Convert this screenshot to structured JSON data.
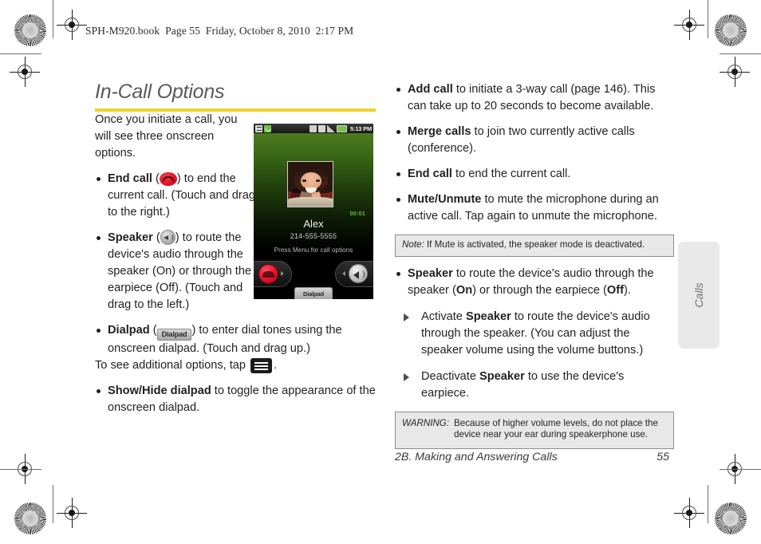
{
  "running_head": "SPH-M920.book  Page 55  Friday, October 8, 2010  2:17 PM",
  "section": {
    "title": "In-Call Options",
    "rule_color": "#edd42b"
  },
  "left_column": {
    "intro": "Once you initiate a call, you will see three onscreen options.",
    "bullets": [
      {
        "label": "End call",
        "icon": "end-call-icon",
        "text_before": " (",
        "text_after": ") to end the current call. (Touch and drag to the right.)"
      },
      {
        "label": "Speaker",
        "icon": "speaker-icon",
        "text_before": " (",
        "text_after": ") to route the device's audio through the speaker (On) or through the earpiece (Off). (Touch and drag to the left.)"
      },
      {
        "label": "Dialpad",
        "icon": "dialpad-icon",
        "icon_label": "Dialpad",
        "text_before": " (",
        "text_after": ") to enter dial tones using the onscreen dialpad. (Touch and drag up.)"
      }
    ],
    "additional_options_lead": "To see additional options, tap",
    "additional_options_icon": "menu-icon",
    "additional_options_end": ".",
    "show_hide_bullet": {
      "label": "Show/Hide dialpad",
      "text": " to toggle the appearance of the onscreen dialpad."
    }
  },
  "right_column": {
    "bullets": [
      {
        "label": "Add call",
        "text": " to initiate a 3-way call (page 146). This can take up to 20 seconds to become available."
      },
      {
        "label": "Merge calls",
        "text": " to join two currently active calls (conference)."
      },
      {
        "label": "End call",
        "text": " to end the current call."
      },
      {
        "label": "Mute/Unmute",
        "text": " to mute the microphone during an active call. Tap again to unmute the microphone."
      }
    ],
    "note": {
      "lead": "Note:",
      "text": "If Mute is activated, the speaker mode is deactivated."
    },
    "speaker_bullet": {
      "label": "Speaker",
      "part1": " to route the device's audio through the speaker (",
      "on": "On",
      "part2": ") or through the earpiece (",
      "off": "Off",
      "part3": ")."
    },
    "sub_items": [
      {
        "pre": "Activate ",
        "bold": "Speaker",
        "post": " to route the device's audio through the speaker. (You can adjust the speaker volume using the volume buttons.)"
      },
      {
        "pre": "Deactivate ",
        "bold": "Speaker",
        "post": " to use the device's earpiece."
      }
    ],
    "warning": {
      "lead": "WARNING:",
      "text": "Because of higher volume levels, do not place the device near your ear during speakerphone use."
    }
  },
  "device_screenshot": {
    "status_bar": {
      "time": "5:13 PM",
      "icons": [
        "message-icon",
        "active-call-icon",
        "bluetooth-icon",
        "vibrate-icon",
        "signal-icon",
        "battery-icon"
      ]
    },
    "caller_name": "Alex",
    "caller_number": "214-555-5555",
    "hint": "Press Menu for call options",
    "call_timer": "00:01",
    "end_call_button": "end-call-button",
    "speaker_button": "speaker-button",
    "dialpad_tab_label": "Dialpad"
  },
  "thumb_tab": {
    "label": "Calls"
  },
  "footer": {
    "chapter": "2B. Making and Answering Calls",
    "page_number": "55"
  }
}
